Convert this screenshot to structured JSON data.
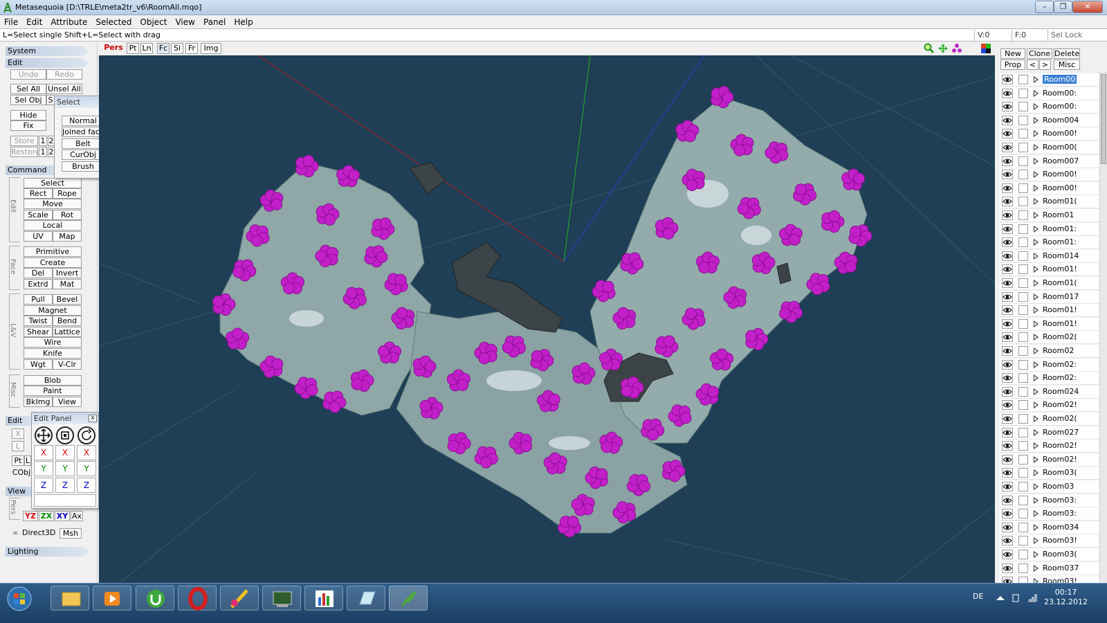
{
  "window": {
    "title": "Metasequoia [D:\\TRLE\\meta2tr_v6\\RoomAll.mqo]",
    "minimize": "–",
    "maximize": "❐",
    "close": "✕"
  },
  "menu": [
    "File",
    "Edit",
    "Attribute",
    "Selected",
    "Object",
    "View",
    "Panel",
    "Help"
  ],
  "status": {
    "hint": "L=Select single  Shift+L=Select with drag",
    "v": "V:0",
    "f": "F:0",
    "sellock": "Sel Lock"
  },
  "left": {
    "system": "System",
    "edit": "Edit",
    "undo": "Undo",
    "redo": "Redo",
    "selall": "Sel All",
    "unselall": "Unsel All",
    "selobj": "Sel Obj",
    "selobj2": "S",
    "hide": "Hide",
    "fix": "Fix",
    "store": "Store",
    "restore": "Restore",
    "slot1": "1",
    "slot2": "2",
    "command": "Command",
    "grp_edit": "Edit",
    "grp_face": "Face",
    "grp_lv": "L&V",
    "grp_misc": "Misc",
    "cmds": {
      "select": "Select",
      "rect": "Rect",
      "rope": "Rope",
      "move": "Move",
      "scale": "Scale",
      "rot": "Rot",
      "local": "Local",
      "uv": "UV",
      "map": "Map",
      "primitive": "Primitive",
      "create": "Create",
      "del": "Del",
      "invert": "Invert",
      "extrd": "Extrd",
      "mat": "Mat",
      "pull": "Pull",
      "bevel": "Bevel",
      "magnet": "Magnet",
      "twist": "Twist",
      "bend": "Bend",
      "shear": "Shear",
      "lattice": "Lattice",
      "wire": "Wire",
      "knife": "Knife",
      "wgt": "Wgt",
      "vclr": "V-Clr",
      "blob": "Blob",
      "paint": "Paint",
      "bkimg": "BkImg",
      "view": "View"
    },
    "editop": "Edit Op",
    "op_x": "X",
    "op_l": "L",
    "op_pt": "Pt",
    "op_l2": "L",
    "op_cobj": "CObj",
    "view": "View",
    "view_pers": "Pers",
    "yz": "YZ",
    "zx": "ZX",
    "xy": "XY",
    "ax": "Ax",
    "direct3d": "Direct3D",
    "msh": "Msh",
    "lighting": "Lighting"
  },
  "select_popup": {
    "title": "Select",
    "items": [
      "Normal",
      "Joined face",
      "Belt",
      "CurObj",
      "Brush"
    ]
  },
  "edit_panel": {
    "title": "Edit Panel",
    "close": "x",
    "x": "X",
    "y": "Y",
    "z": "Z"
  },
  "viewport_toolbar": {
    "pers": "Pers",
    "pt": "Pt",
    "ln": "Ln",
    "fc": "Fc",
    "si": "Si",
    "fr": "Fr",
    "img": "Img"
  },
  "objects_panel": {
    "new": "New",
    "clone": "Clone",
    "delete": "Delete",
    "prop": "Prop",
    "prev": "<",
    "next": ">",
    "misc": "Misc",
    "items": [
      "Room00",
      "Room00:",
      "Room00:",
      "Room004",
      "Room00!",
      "Room00(",
      "Room007",
      "Room00!",
      "Room00!",
      "Room01(",
      "Room01",
      "Room01:",
      "Room01:",
      "Room014",
      "Room01!",
      "Room01(",
      "Room017",
      "Room01!",
      "Room01!",
      "Room02(",
      "Room02",
      "Room02:",
      "Room02:",
      "Room024",
      "Room02!",
      "Room02(",
      "Room027",
      "Room02!",
      "Room02!",
      "Room03(",
      "Room03",
      "Room03:",
      "Room03:",
      "Room034",
      "Room03!",
      "Room03(",
      "Room037",
      "Room03!"
    ]
  },
  "taskbar": {
    "lang": "DE",
    "time": "00:17",
    "date": "23.12.2012"
  },
  "colors": {
    "viewport_bg": "#1e3f56",
    "foliage": "#c21fc9",
    "terrain": "#8fa7a6",
    "selection": "#3a7fd6"
  }
}
